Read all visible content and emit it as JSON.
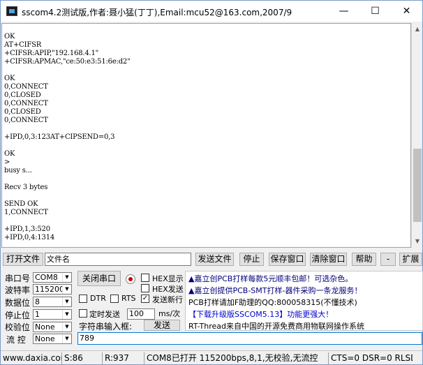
{
  "window": {
    "title": "sscom4.2测试版,作者:聂小猛(丁丁),Email:mcu52@163.com,2007/9",
    "min_glyph": "—",
    "max_glyph": "☐",
    "close_glyph": "✕"
  },
  "terminal": {
    "lines": [
      "OK",
      "AT+CIFSR",
      "+CIFSR:APIP,\"192.168.4.1\"",
      "+CIFSR:APMAC,\"ce:50:e3:51:6e:d2\"",
      "",
      "OK",
      "0,CONNECT",
      "0,CLOSED",
      "0,CONNECT",
      "0,CLOSED",
      "0,CONNECT",
      "",
      "+IPD,0,3:123AT+CIPSEND=0,3",
      "",
      "OK",
      ">",
      "busy s...",
      "",
      "Recv 3 bytes",
      "",
      "SEND OK",
      "1,CONNECT",
      "",
      "+IPD,1,3:520",
      "+IPD,0,4:1314"
    ]
  },
  "toolbar": {
    "open_file": "打开文件",
    "filename": "文件名",
    "send_file": "发送文件",
    "stop": "停止",
    "save_window": "保存窗口",
    "clear_window": "清除窗口",
    "help": "帮助",
    "minus": "-",
    "expand": "扩展"
  },
  "settings": {
    "port_label": "串口号",
    "port_value": "COM8",
    "baud_label": "波特率",
    "baud_value": "115200",
    "databits_label": "数据位",
    "databits_value": "8",
    "stopbits_label": "停止位",
    "stopbits_value": "1",
    "parity_label": "校验位",
    "parity_value": "None",
    "flow_label": "流 控",
    "flow_value": "None",
    "close_port_button": "关闭串口"
  },
  "options": {
    "hex_display": "HEX显示",
    "hex_send": "HEX发送",
    "dtr": "DTR",
    "rts": "RTS",
    "send_newline": "发送新行",
    "timed_send": "定时发送",
    "timed_interval": "100",
    "timed_unit": "ms/次",
    "input_label": "字符串输入框:",
    "send_button": "发送",
    "input_value": "789"
  },
  "ads": {
    "line1": "▲嘉立创PCB打样每款5元顺丰包邮！可选杂色。",
    "line2": "▲嘉立创提供PCB-SMT打样-器件采购一条龙服务！",
    "line3": "PCB打样请加F助理的QQ:800058315(不懂技术)",
    "line4": "【下载升级版SSCOM5.13】功能更强大！",
    "line5": "RT-Thread来自中国的开源免费商用物联网操作系统",
    "color_red": "#e00000",
    "color_blue": "#0000cc",
    "color_navy": "#00007a"
  },
  "status": {
    "website": "www.daxia.com",
    "sent": "S:86",
    "received": "R:937",
    "port_status": "COM8已打开  115200bps,8,1,无校验,无流控",
    "lines": "CTS=0 DSR=0 RLSD"
  }
}
